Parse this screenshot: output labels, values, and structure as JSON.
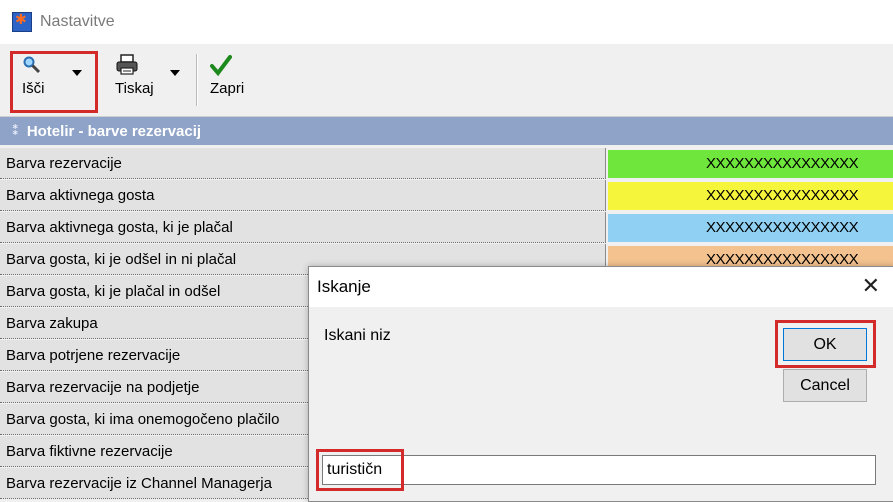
{
  "window": {
    "title": "Nastavitve"
  },
  "toolbar": {
    "search_label": "Išči",
    "print_label": "Tiskaj",
    "close_label": "Zapri"
  },
  "section": {
    "title": "Hotelir - barve rezervacij"
  },
  "rows": [
    {
      "label": "Barva rezervacije",
      "value": "XXXXXXXXXXXXXXXX",
      "color": "#6ee63b"
    },
    {
      "label": "Barva aktivnega gosta",
      "value": "XXXXXXXXXXXXXXXX",
      "color": "#f5f53c"
    },
    {
      "label": "Barva aktivnega gosta, ki je plačal",
      "value": "XXXXXXXXXXXXXXXX",
      "color": "#8fd0f3"
    },
    {
      "label": "Barva gosta, ki je odšel in ni plačal",
      "value": "XXXXXXXXXXXXXXXX",
      "color": "#f3c28f"
    },
    {
      "label": "Barva gosta, ki je plačal in odšel",
      "value": "",
      "color": "#f0f0f0"
    },
    {
      "label": "Barva zakupa",
      "value": "",
      "color": "#f0f0f0"
    },
    {
      "label": "Barva potrjene rezervacije",
      "value": "",
      "color": "#f0f0f0"
    },
    {
      "label": "Barva rezervacije na podjetje",
      "value": "",
      "color": "#f0f0f0"
    },
    {
      "label": "Barva gosta, ki ima onemogočeno plačilo",
      "value": "",
      "color": "#f0f0f0"
    },
    {
      "label": "Barva fiktivne rezervacije",
      "value": "",
      "color": "#f0f0f0"
    },
    {
      "label": "Barva rezervacije iz Channel Managerja",
      "value": "",
      "color": "#f0f0f0"
    }
  ],
  "dialog": {
    "title": "Iskanje",
    "prompt": "Iskani niz",
    "ok_label": "OK",
    "cancel_label": "Cancel",
    "input_value": "turističn",
    "close_glyph": "✕"
  },
  "highlight_color": "#d32a2a"
}
